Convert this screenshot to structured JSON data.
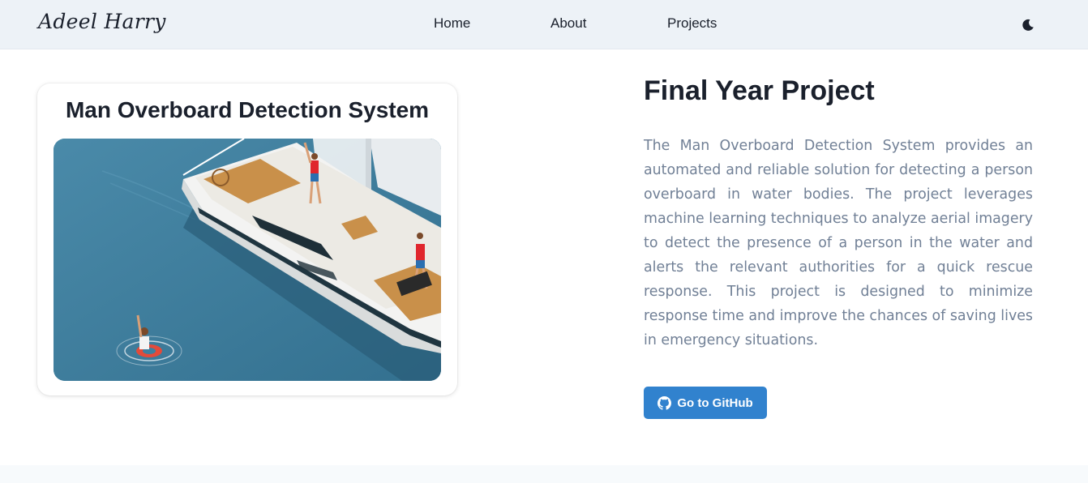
{
  "nav": {
    "brand": "Adeel Harry",
    "links": [
      {
        "label": "Home"
      },
      {
        "label": "About"
      },
      {
        "label": "Projects"
      }
    ],
    "theme_toggle_icon": "moon-icon"
  },
  "project_card": {
    "title": "Man Overboard Detection System",
    "image_icon": "sailboat-man-overboard-illustration"
  },
  "project": {
    "heading": "Final Year Project",
    "description": "The Man Overboard Detection System provides an automated and reliable solution for detecting a person overboard in water bodies. The project leverages machine learning techniques to analyze aerial imagery to detect the presence of a person in the water and alerts the relevant authorities for a quick rescue response. This project is designed to minimize response time and improve the chances of saving lives in emergency situations.",
    "github_button": {
      "label": "Go to GitHub",
      "icon": "github-icon"
    }
  },
  "colors": {
    "navbar_bg": "#edf2f7",
    "accent": "#3182ce",
    "text_muted": "#718096",
    "water": "#3e7f9f"
  }
}
